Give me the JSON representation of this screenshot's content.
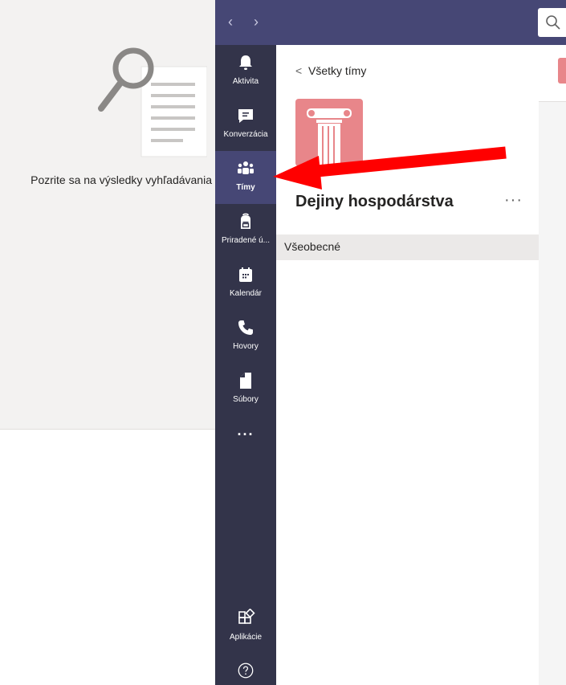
{
  "search": {
    "message": "Pozrite sa na výsledky vyhľadávania"
  },
  "title_bar": {
    "back_arrow": "‹",
    "forward_arrow": "›",
    "search_icon": "search-icon"
  },
  "app_bar": {
    "items": [
      {
        "label": "Aktivita",
        "icon": "bell-icon",
        "active": false
      },
      {
        "label": "Konverzácia",
        "icon": "chat-icon",
        "active": false
      },
      {
        "label": "Tímy",
        "icon": "teams-icon",
        "active": true
      },
      {
        "label": "Priradené ú...",
        "icon": "backpack-icon",
        "active": false
      },
      {
        "label": "Kalendár",
        "icon": "calendar-icon",
        "active": false
      },
      {
        "label": "Hovory",
        "icon": "phone-icon",
        "active": false
      },
      {
        "label": "Súbory",
        "icon": "file-icon",
        "active": false
      }
    ],
    "more": "...",
    "apps_label": "Aplikácie",
    "help_icon": "help-icon"
  },
  "teams_pane": {
    "back_label": "Všetky tímy",
    "team_name": "Dejiny hospodárstva",
    "more": "···",
    "channels": [
      "Všeobecné"
    ]
  },
  "colors": {
    "title_bar": "#464775",
    "app_bar": "#33344a",
    "app_bar_active": "#464775",
    "team_avatar": "#e8868a",
    "annotation_arrow": "#ff0000"
  }
}
